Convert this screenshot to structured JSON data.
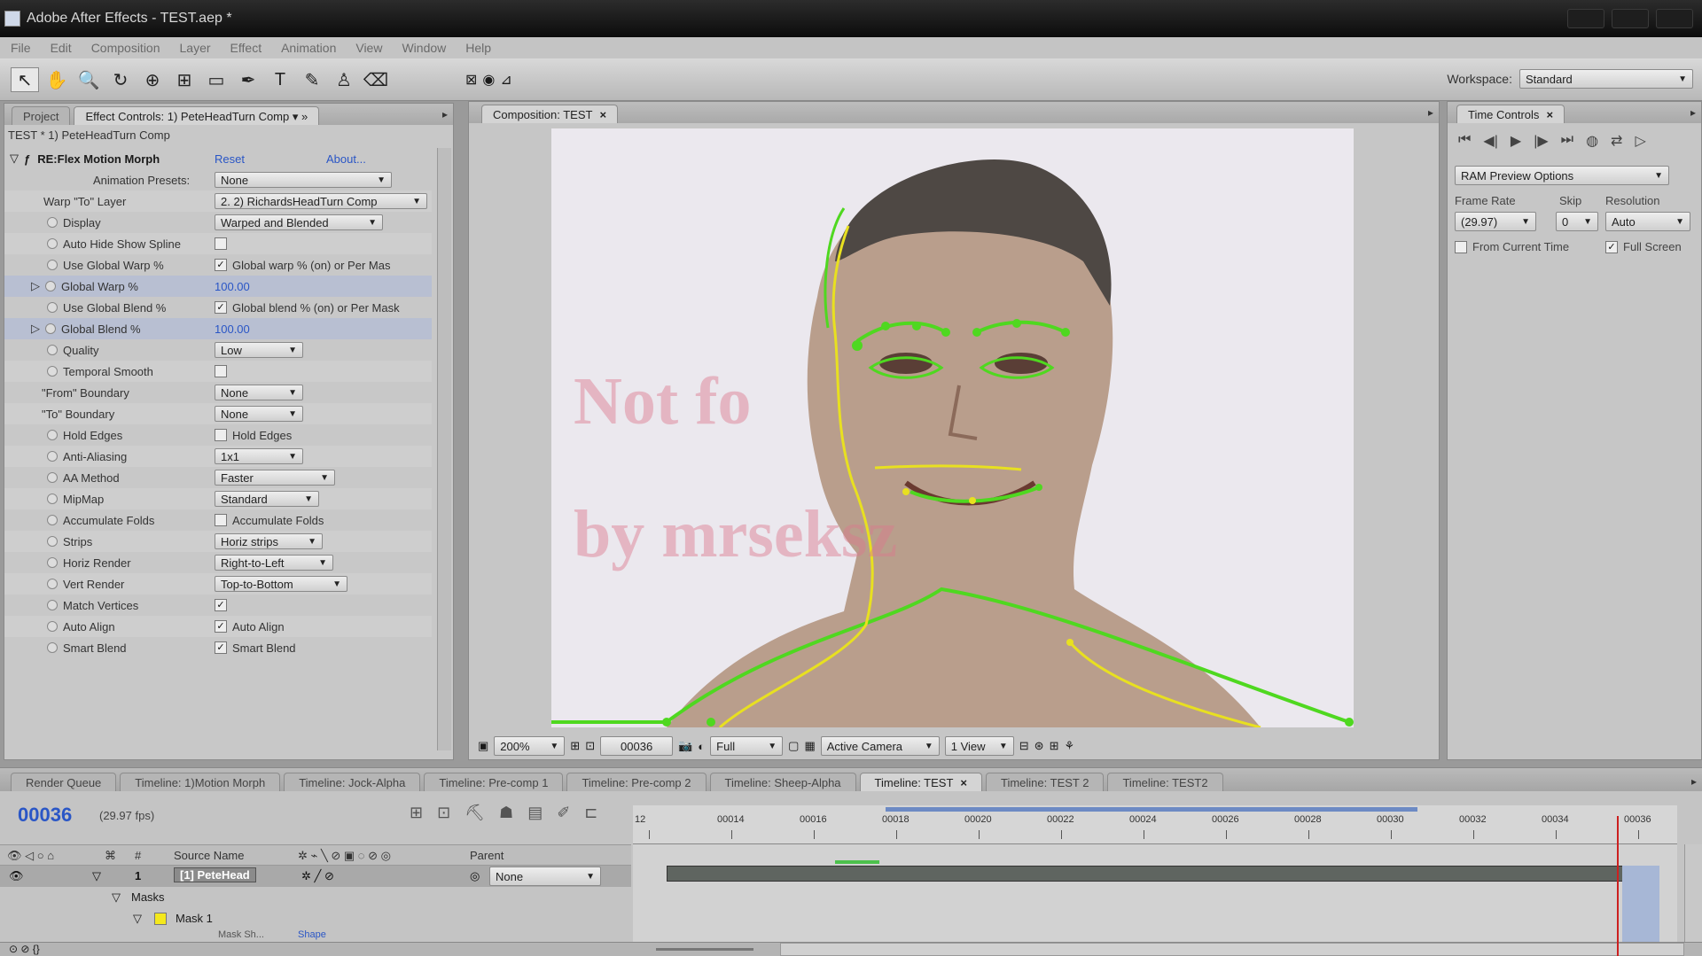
{
  "window": {
    "title": "Adobe After Effects - TEST.aep *"
  },
  "menu": [
    "File",
    "Edit",
    "Composition",
    "Layer",
    "Effect",
    "Animation",
    "View",
    "Window",
    "Help"
  ],
  "workspace": {
    "label": "Workspace:",
    "value": "Standard"
  },
  "left_panel": {
    "tabs": {
      "project": "Project",
      "effect_controls": "Effect Controls: 1) PeteHeadTurn Comp"
    },
    "header": "TEST * 1) PeteHeadTurn Comp",
    "effect": {
      "name": "RE:Flex Motion Morph",
      "reset": "Reset",
      "about": "About..."
    },
    "rows": [
      {
        "label": "Animation Presets:",
        "kind": "dropdown",
        "value": "None"
      },
      {
        "label": "Warp \"To\" Layer",
        "kind": "dropdown",
        "value": "2. 2) RichardsHeadTurn Comp"
      },
      {
        "label": "Display",
        "kind": "dropdown",
        "value": "Warped and Blended"
      },
      {
        "label": "Auto Hide Show Spline",
        "kind": "check",
        "checked": false,
        "text": ""
      },
      {
        "label": "Use Global Warp %",
        "kind": "check",
        "checked": true,
        "text": "Global warp % (on) or Per Mas"
      },
      {
        "label": "Global Warp %",
        "kind": "number",
        "value": "100.00"
      },
      {
        "label": "Use Global Blend %",
        "kind": "check",
        "checked": true,
        "text": "Global blend % (on) or Per Mask"
      },
      {
        "label": "Global Blend %",
        "kind": "number",
        "value": "100.00"
      },
      {
        "label": "Quality",
        "kind": "dropdown",
        "value": "Low"
      },
      {
        "label": "Temporal Smooth",
        "kind": "check",
        "checked": false,
        "text": ""
      },
      {
        "label": "\"From\" Boundary",
        "kind": "dropdown",
        "value": "None"
      },
      {
        "label": "\"To\" Boundary",
        "kind": "dropdown",
        "value": "None"
      },
      {
        "label": "Hold Edges",
        "kind": "check",
        "checked": false,
        "text": "Hold Edges"
      },
      {
        "label": "Anti-Aliasing",
        "kind": "dropdown",
        "value": "1x1"
      },
      {
        "label": "AA Method",
        "kind": "dropdown",
        "value": "Faster"
      },
      {
        "label": "MipMap",
        "kind": "dropdown",
        "value": "Standard"
      },
      {
        "label": "Accumulate Folds",
        "kind": "check",
        "checked": false,
        "text": "Accumulate Folds"
      },
      {
        "label": "Strips",
        "kind": "dropdown",
        "value": "Horiz strips"
      },
      {
        "label": "Horiz Render",
        "kind": "dropdown",
        "value": "Right-to-Left"
      },
      {
        "label": "Vert Render",
        "kind": "dropdown",
        "value": "Top-to-Bottom"
      },
      {
        "label": "Match Vertices",
        "kind": "check",
        "checked": true,
        "text": ""
      },
      {
        "label": "Auto Align",
        "kind": "check",
        "checked": true,
        "text": "Auto Align"
      },
      {
        "label": "Smart Blend",
        "kind": "check",
        "checked": true,
        "text": "Smart Blend"
      }
    ]
  },
  "composition": {
    "tab": "Composition: TEST",
    "watermark": [
      "Not fo",
      "by mrseksz"
    ],
    "controls": {
      "zoom": "200%",
      "timecode": "00036",
      "resolution": "Full",
      "camera": "Active Camera",
      "views": "1 View"
    }
  },
  "time_controls": {
    "tab": "Time Controls",
    "ram_preview": "RAM Preview Options",
    "frame_rate_label": "Frame Rate",
    "frame_rate": "(29.97)",
    "skip_label": "Skip",
    "skip": "0",
    "resolution_label": "Resolution",
    "resolution": "Auto",
    "from_current": "From Current Time",
    "full_screen": "Full Screen"
  },
  "timeline": {
    "tabs": [
      "Render Queue",
      "Timeline: 1)Motion Morph",
      "Timeline: Jock-Alpha",
      "Timeline: Pre-comp 1",
      "Timeline: Pre-comp 2",
      "Timeline: Sheep-Alpha",
      "Timeline: TEST",
      "Timeline: TEST 2",
      "Timeline: TEST2"
    ],
    "active_tab": "Timeline: TEST",
    "current_time": "00036",
    "fps": "(29.97 fps)",
    "columns": {
      "number": "#",
      "source": "Source Name",
      "parent": "Parent"
    },
    "layer": {
      "number": "1",
      "name": "[1] PeteHead",
      "parent": "None"
    },
    "masks_label": "Masks",
    "mask1": "Mask 1",
    "mask_shape": "Mask Sh...",
    "mask_shape_value": "Shape",
    "ruler_labels": [
      "12",
      "00014",
      "00016",
      "00018",
      "00020",
      "00022",
      "00024",
      "00026",
      "00028",
      "00030",
      "00032",
      "00034",
      "00036"
    ]
  }
}
